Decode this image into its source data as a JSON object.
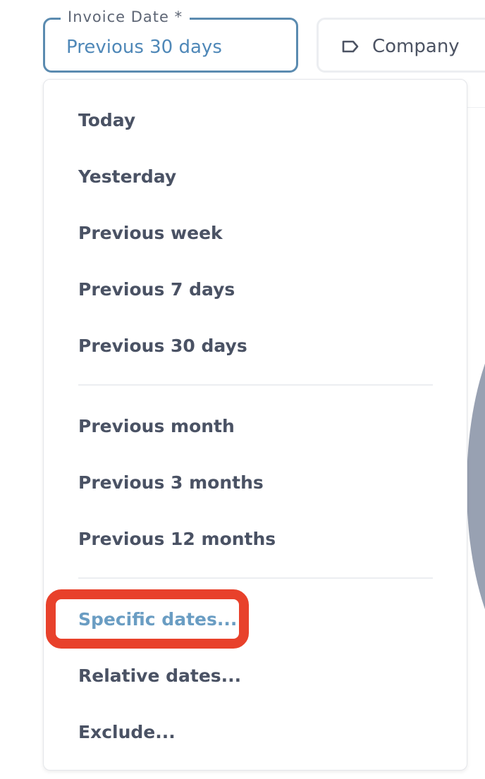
{
  "filters": {
    "invoice_date": {
      "label": "Invoice Date *",
      "value": "Previous 30 days"
    },
    "company": {
      "label": "Company",
      "icon": "tag-icon"
    }
  },
  "menu": {
    "group1": [
      "Today",
      "Yesterday",
      "Previous week",
      "Previous 7 days",
      "Previous 30 days"
    ],
    "group2": [
      "Previous month",
      "Previous 3 months",
      "Previous 12 months"
    ],
    "group3": [
      "Specific dates...",
      "Relative dates...",
      "Exclude..."
    ]
  },
  "highlighted_item": "Specific dates...",
  "colors": {
    "accent": "#4f88b8",
    "field_border": "#5b8bb0",
    "menu_text": "#4a5264",
    "highlight": "#e8412b"
  }
}
